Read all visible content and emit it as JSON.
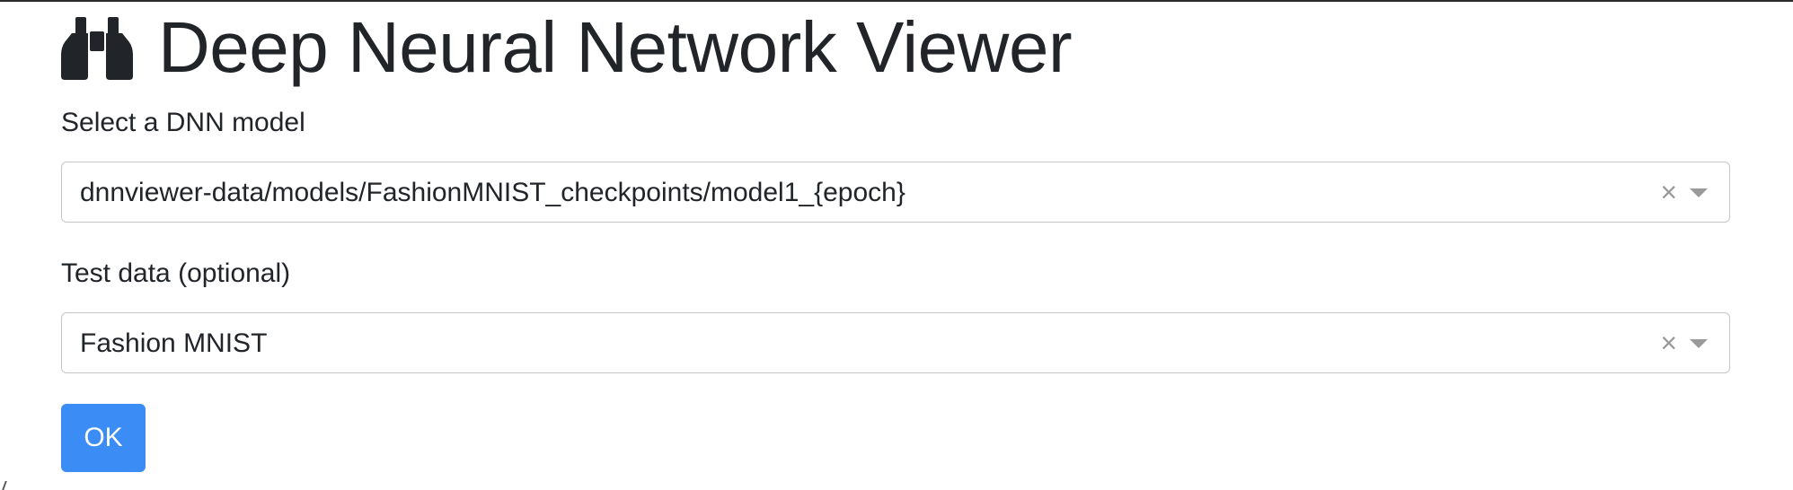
{
  "header": {
    "title": "Deep Neural Network Viewer",
    "icon": "binoculars-icon"
  },
  "model_select": {
    "label": "Select a DNN model",
    "value": "dnnviewer-data/models/FashionMNIST_checkpoints/model1_{epoch}",
    "clear_glyph": "×"
  },
  "test_data_select": {
    "label": "Test data (optional)",
    "value": "Fashion MNIST",
    "clear_glyph": "×"
  },
  "actions": {
    "ok_label": "OK"
  },
  "colors": {
    "text": "#212529",
    "primary_button": "#3b8df5",
    "select_border": "#c5c5c5",
    "indicator": "#9a9a9a"
  }
}
